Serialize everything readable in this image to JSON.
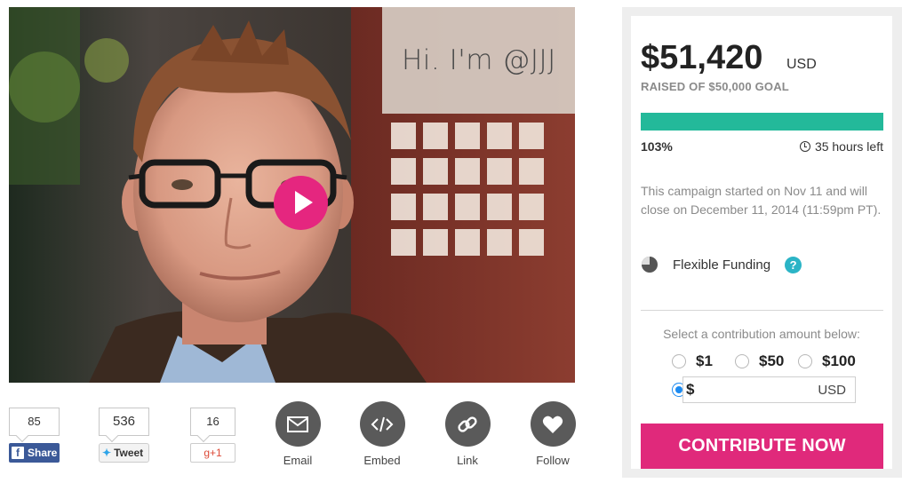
{
  "video": {
    "caption": "Hi. I'm @JJJ"
  },
  "share": {
    "facebook": {
      "count": "85",
      "label": "Share"
    },
    "twitter": {
      "count": "536",
      "label": "Tweet"
    },
    "googleplus": {
      "count": "16",
      "label": "g+1"
    }
  },
  "actions": [
    {
      "label": "Email",
      "icon": "envelope-icon"
    },
    {
      "label": "Embed",
      "icon": "code-icon"
    },
    {
      "label": "Link",
      "icon": "link-icon"
    },
    {
      "label": "Follow",
      "icon": "heart-icon"
    }
  ],
  "campaign": {
    "amount": "$51,420",
    "currency": "USD",
    "goal_text": "RAISED OF $50,000 GOAL",
    "progress_fraction": 1.0,
    "percent_label": "103%",
    "time_left": "35 hours left",
    "description": "This campaign started on Nov 11 and will close on December 11, 2014 (11:59pm PT).",
    "funding_type": "Flexible Funding",
    "help_symbol": "?"
  },
  "contribution": {
    "prompt": "Select a contribution amount below:",
    "options": [
      "$1",
      "$50",
      "$100"
    ],
    "custom_prefix": "$",
    "custom_value": "",
    "custom_currency": "USD",
    "button_label": "CONTRIBUTE NOW"
  },
  "colors": {
    "accent_pink": "#e0297b",
    "progress_green": "#23b99a",
    "facebook_blue": "#3b5998",
    "help_teal": "#2bb4c6",
    "radio_blue": "#1d8bf1"
  }
}
